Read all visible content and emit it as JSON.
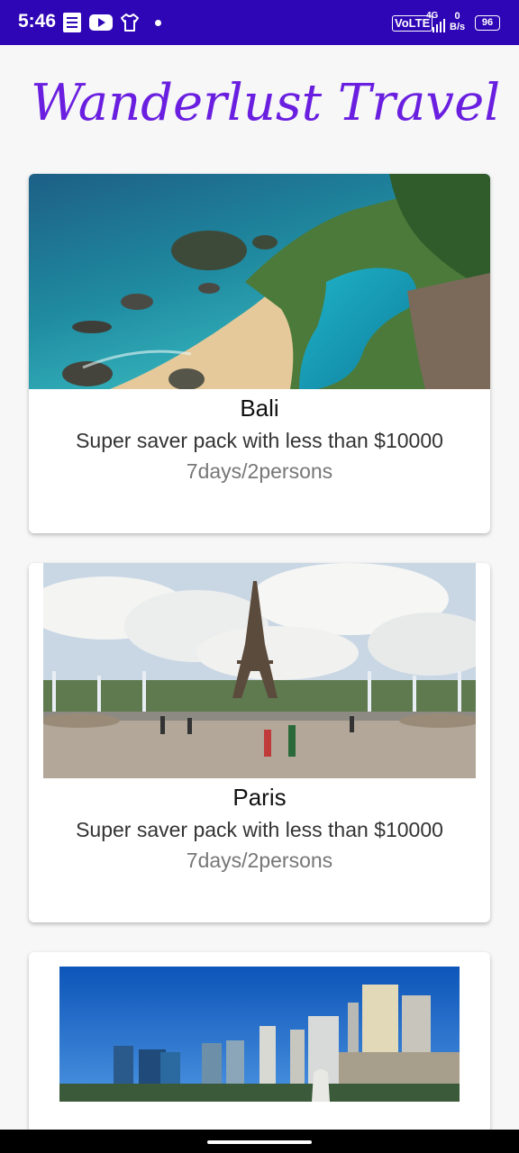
{
  "status_bar": {
    "time": "5:46",
    "volte": "VoLTE",
    "network": "4G",
    "speed_value": "0",
    "speed_unit": "B/s",
    "battery": "96",
    "icons": [
      "document-icon",
      "youtube-icon",
      "shirt-icon",
      "notification-dot-icon",
      "signal-icon"
    ]
  },
  "app": {
    "title": "Wanderlust Travel",
    "accent_color": "#6a1fe0",
    "status_bar_color": "#2f06b5"
  },
  "destinations": [
    {
      "name": "Bali",
      "description": "Super saver pack with less than $10000",
      "duration": "7days/2persons",
      "image": "bali-coast-photo"
    },
    {
      "name": "Paris",
      "description": "Super saver pack with less than $10000",
      "duration": "7days/2persons",
      "image": "eiffel-tower-photo"
    },
    {
      "name": "",
      "description": "",
      "duration": "",
      "image": "singapore-skyline-photo"
    }
  ]
}
